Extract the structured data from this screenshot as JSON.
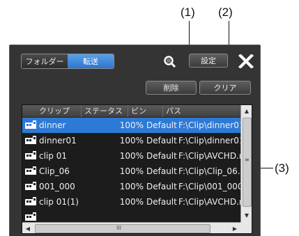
{
  "callouts": {
    "one": "(1)",
    "two": "(2)",
    "three": "(3)"
  },
  "tabs": {
    "folder": "フォルダー",
    "transfer": "転送"
  },
  "toolbar": {
    "settings": "設定",
    "delete": "削除",
    "clear": "クリア"
  },
  "icons": {
    "search": "search-icon",
    "close": "close-icon",
    "clip": "clip-icon"
  },
  "columns": {
    "clip": "クリップ",
    "status": "ステータス",
    "bin": "ビン",
    "path": "パス"
  },
  "rows": [
    {
      "clip": "dinner",
      "status": "100%",
      "bin": "Default",
      "path": "F:\\Clip\\dinner01.",
      "selected": true
    },
    {
      "clip": "dinner01",
      "status": "100%",
      "bin": "Default",
      "path": "F:\\Clip\\dinner01."
    },
    {
      "clip": "clip 01",
      "status": "100%",
      "bin": "Default",
      "path": "F:\\Clip\\AVCHD.m"
    },
    {
      "clip": "Clip_06",
      "status": "100%",
      "bin": "Default",
      "path": "F:\\Clip\\Clip_06.a"
    },
    {
      "clip": "001_000",
      "status": "100%",
      "bin": "Default",
      "path": "F:\\Clip\\001_000."
    },
    {
      "clip": "clip 01(1)",
      "status": "100%",
      "bin": "Default",
      "path": "F:\\Clip\\AVCHD.m"
    },
    {
      "clip": "",
      "status": "",
      "bin": "",
      "path": ""
    }
  ],
  "scrollbar": {
    "grip_v": "≡",
    "grip_h": "III"
  },
  "colors": {
    "selection": "#2d7ad6",
    "active_tab": "#3a86dc",
    "panel": "#343434"
  }
}
